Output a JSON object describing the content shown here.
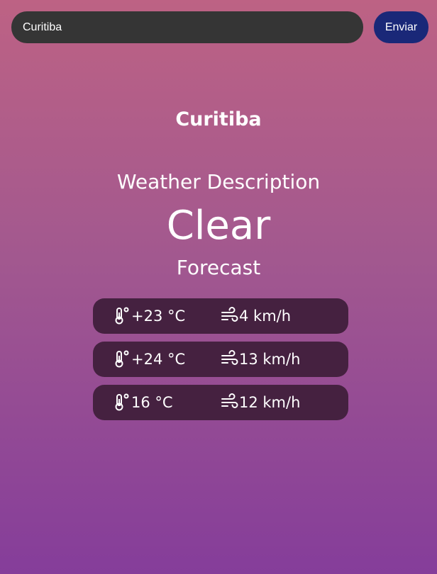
{
  "search": {
    "value": "Curitiba",
    "button_label": "Enviar"
  },
  "weather": {
    "city": "Curitiba",
    "description_label": "Weather Description",
    "description_value": "Clear",
    "forecast_title": "Forecast"
  },
  "forecast": [
    {
      "temperature": "+23 °C",
      "wind": "4 km/h"
    },
    {
      "temperature": "+24 °C",
      "wind": "13 km/h"
    },
    {
      "temperature": "16 °C",
      "wind": "12 km/h"
    }
  ],
  "icons": {
    "temperature": "thermometer-icon",
    "wind": "wind-icon"
  },
  "colors": {
    "background_top": "#bd6284",
    "background_bottom": "#853d9a",
    "input_bg": "#353535",
    "button_bg": "#1a2878",
    "row_bg": "#452140"
  }
}
